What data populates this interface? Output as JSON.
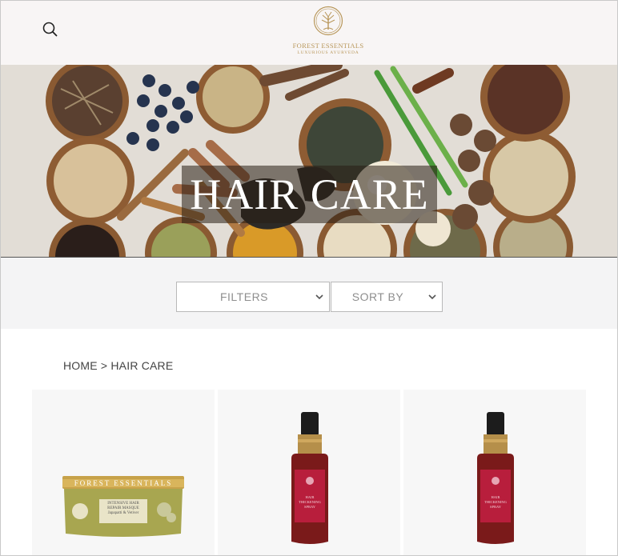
{
  "header": {
    "logo": {
      "brand": "FOREST ESSENTIALS",
      "tagline": "LUXURIOUS AYURVEDA"
    },
    "search_icon": "search-icon"
  },
  "hero": {
    "title": "HAIR CARE"
  },
  "filters": {
    "filters_label": "FILTERS",
    "sort_label": "SORT BY"
  },
  "breadcrumb": {
    "home": "HOME",
    "separator": " > ",
    "current": "HAIR CARE"
  },
  "products": [
    {
      "type": "jar",
      "label_brand": "FOREST ESSENTIALS",
      "label_line1": "INTENSIVE HAIR",
      "label_line2": "REPAIR MASQUE",
      "label_line3": "Japapatti & Vetiver"
    },
    {
      "type": "bottle",
      "label_line1": "HAIR",
      "label_line2": "THICKENING",
      "label_line3": "SPRAY"
    },
    {
      "type": "bottle",
      "label_line1": "HAIR",
      "label_line2": "THICKENING",
      "label_line3": "SPRAY"
    }
  ],
  "colors": {
    "gold": "#b8975a",
    "bottle_red": "#b81e3c",
    "jar_olive": "#a8a650"
  }
}
